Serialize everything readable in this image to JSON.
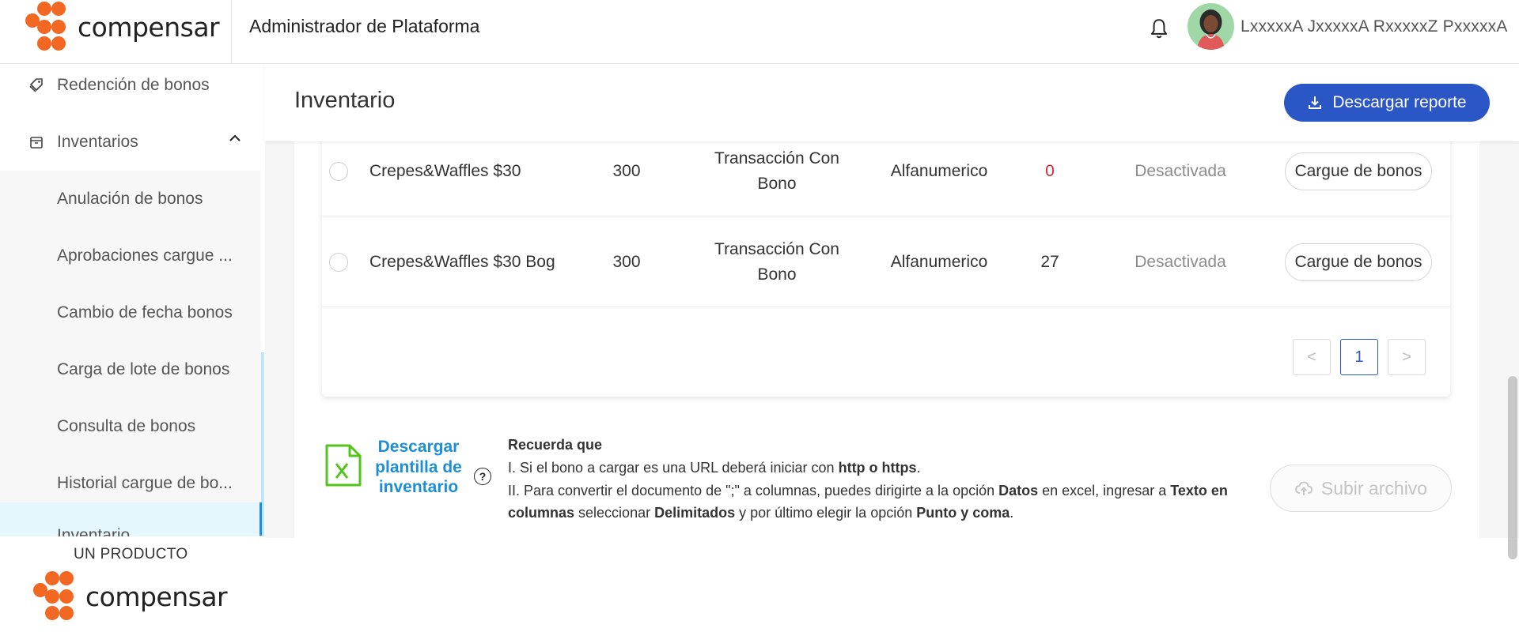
{
  "header": {
    "logo_text": "compensar",
    "title": "Administrador de Plataforma",
    "user_name": "LxxxxxA JxxxxxA RxxxxxZ PxxxxxA"
  },
  "sidebar": {
    "items": [
      {
        "label": "Redención de bonos",
        "icon": "tag-icon"
      },
      {
        "label": "Inventarios",
        "icon": "box-icon"
      }
    ],
    "subitems": [
      {
        "label": "Anulación de bonos"
      },
      {
        "label": "Aprobaciones cargue ..."
      },
      {
        "label": "Cambio de fecha bonos"
      },
      {
        "label": "Carga de lote de bonos"
      },
      {
        "label": "Consulta de bonos"
      },
      {
        "label": "Historial cargue de bo..."
      },
      {
        "label": "Inventario"
      }
    ],
    "footer_tag": "UN PRODUCTO",
    "footer_logo_text": "compensar"
  },
  "page": {
    "title": "Inventario",
    "download_label": "Descargar reporte"
  },
  "table": {
    "rows": [
      {
        "name": "Crepes&Waffles $30",
        "qty": "300",
        "type": "Transacción Con Bono",
        "code": "Alfanumerico",
        "available": "0",
        "status": "Desactivada",
        "action": "Cargue de bonos"
      },
      {
        "name": "Crepes&Waffles $30 Bog",
        "qty": "300",
        "type": "Transacción Con Bono",
        "code": "Alfanumerico",
        "available": "27",
        "status": "Desactivada",
        "action": "Cargue de bonos"
      }
    ],
    "pagination": {
      "prev": "<",
      "current": "1",
      "next": ">"
    }
  },
  "upload": {
    "template_label": "Descargar plantilla de inventario",
    "help": "?",
    "notes_title": "Recuerda que",
    "note1_a": "I. Si el bono a cargar es una URL deberá iniciar con ",
    "note1_b": "http o https",
    "note1_c": ".",
    "note2_a": "II. Para convertir el documento de \";\" a columnas, puedes dirigirte a la opción ",
    "note2_b": "Datos",
    "note2_c": " en excel, ingresar a ",
    "note2_d": "Texto en columnas",
    "note2_e": " seleccionar ",
    "note2_f": "Delimitados",
    "note2_g": " y por último elegir la opción ",
    "note2_h": "Punto y coma",
    "note2_i": ".",
    "upload_label": "Subir archivo"
  },
  "colors": {
    "brand_orange": "#f26722",
    "primary_blue": "#2a56c6",
    "link_blue": "#1d8fd6",
    "excel_green": "#52c41a",
    "zero_red": "#d9282f"
  }
}
